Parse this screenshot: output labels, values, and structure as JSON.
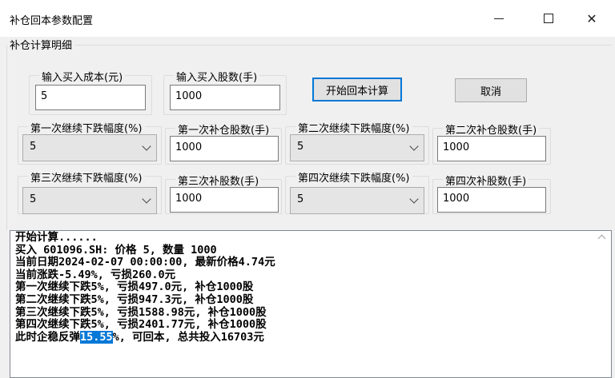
{
  "window": {
    "title": "补仓回本参数配置",
    "controls": [
      "minimize",
      "maximize",
      "close"
    ]
  },
  "section": {
    "title": "补仓计算明细"
  },
  "form": {
    "cost": {
      "label": "输入买入成本(元)",
      "value": "5"
    },
    "shares": {
      "label": "输入买入股数(手)",
      "value": "1000"
    },
    "drop1": {
      "label": "第一次继续下跌幅度(%)",
      "value": "5"
    },
    "add1": {
      "label": "第一次补仓股数(手)",
      "value": "1000"
    },
    "drop2": {
      "label": "第二次继续下跌幅度(%)",
      "value": "5"
    },
    "add2": {
      "label": "第二次补仓股数(手)",
      "value": "1000"
    },
    "drop3": {
      "label": "第三次继续下跌幅度(%)",
      "value": "5"
    },
    "add3": {
      "label": "第三次补股数(手)",
      "value": "1000"
    },
    "drop4": {
      "label": "第四次继续下跌幅度(%)",
      "value": "5"
    },
    "add4": {
      "label": "第四次补股数(手)",
      "value": "1000"
    }
  },
  "buttons": {
    "start": "开始回本计算",
    "cancel": "取消"
  },
  "console": {
    "lines": [
      "开始计算......",
      "买入 601096.SH: 价格 5, 数量 1000",
      "当前日期2024-02-07 00:00:00, 最新价格4.74元",
      "当前涨跌-5.49%, 亏损260.0元",
      "第一次继续下跌5%, 亏损497.0元, 补仓1000股",
      "第二次继续下跌5%, 亏损947.3元, 补仓1000股",
      "第三次继续下跌5%, 亏损1588.98元, 补仓1000股",
      "第四次继续下跌5%, 亏损2401.77元, 补仓1000股"
    ],
    "last_prefix": "此时企稳反弹",
    "last_highlight": "15.55",
    "last_suffix": "%, 可回本, 总共投入16703元"
  }
}
